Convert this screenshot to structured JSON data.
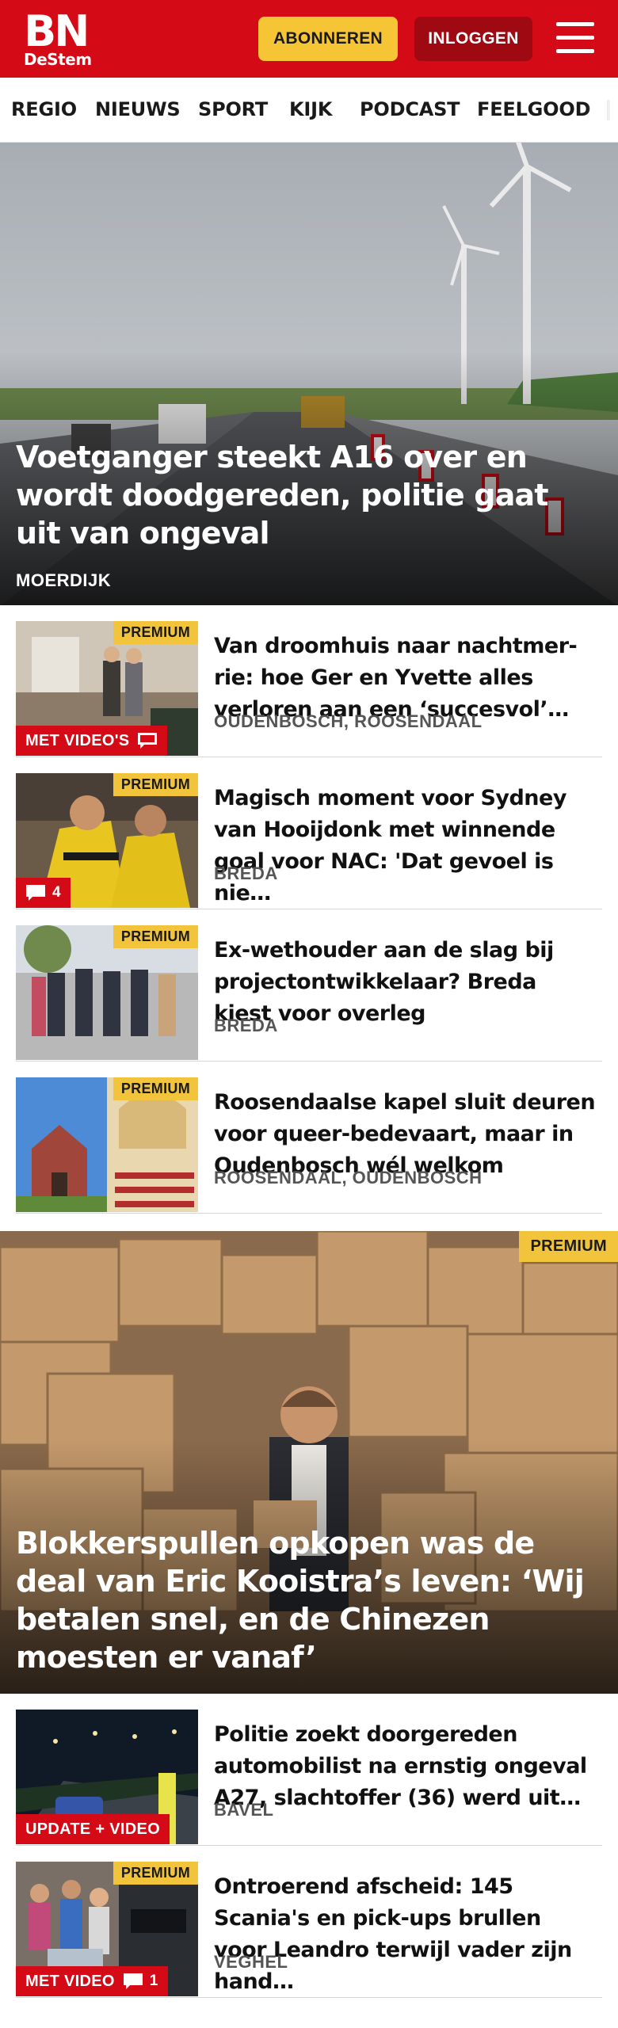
{
  "header": {
    "logo_main": "BN",
    "logo_sub": "DeStem",
    "subscribe_label": "ABONNEREN",
    "login_label": "INLOGGEN"
  },
  "nav": {
    "items": [
      "REGIO",
      "NIEUWS",
      "SPORT",
      "KIJK",
      "PODCAST",
      "FEELGOOD"
    ]
  },
  "hero": {
    "title": "Voetganger steekt A16 over en wordt doodgereden, politie gaat uit van ongeval",
    "location": "MOERDIJK"
  },
  "articles": [
    {
      "title": "Van droomhuis naar nachtmer­rie: hoe Ger en Yvette alles verloren aan een ‘succesvol’…",
      "location": "OUDENBOSCH, ROOSENDAAL",
      "premium": "PREMIUM",
      "badge": "MET VIDEO'S",
      "comments": ""
    },
    {
      "title": "Magisch moment voor Sydney van Hooijdonk met winnende goal voor NAC: 'Dat gevoel is nie…",
      "location": "BREDA",
      "premium": "PREMIUM",
      "badge": "",
      "comments": "4"
    },
    {
      "title": "Ex-wethouder aan de slag bij projectontwikkelaar? Breda kiest voor overleg",
      "location": "BREDA",
      "premium": "PREMIUM",
      "badge": "",
      "comments": ""
    },
    {
      "title": "Roosendaalse kapel sluit deuren voor queer-bedevaart, maar in Oudenbosch wél welkom",
      "location": "ROOSENDAAL, OUDENBOSCH",
      "premium": "PREMIUM",
      "badge": "",
      "comments": ""
    }
  ],
  "feature": {
    "premium": "PREMIUM",
    "title": "Blokkerspullen opkopen was de deal van Eric Kooistra’s leven: ‘Wij betalen snel, en de Chinezen moesten er vanaf’"
  },
  "articles2": [
    {
      "title": "Politie zoekt doorgereden automobilist na ernstig ongeval A27, slachtoffer (36) werd uit…",
      "location": "BAVEL",
      "premium": "",
      "badge": "UPDATE + VIDEO",
      "comments": ""
    },
    {
      "title": "Ontroerend afscheid: 145 Scania's en pick-ups brullen voor Leandro terwijl vader zijn hand…",
      "location": "VEGHEL",
      "premium": "PREMIUM",
      "badge": "MET VIDEO",
      "comments": "1"
    }
  ],
  "colors": {
    "brand_red": "#d40b16",
    "premium_yellow": "#f2c43c",
    "login_dark_red": "#9e0912"
  }
}
